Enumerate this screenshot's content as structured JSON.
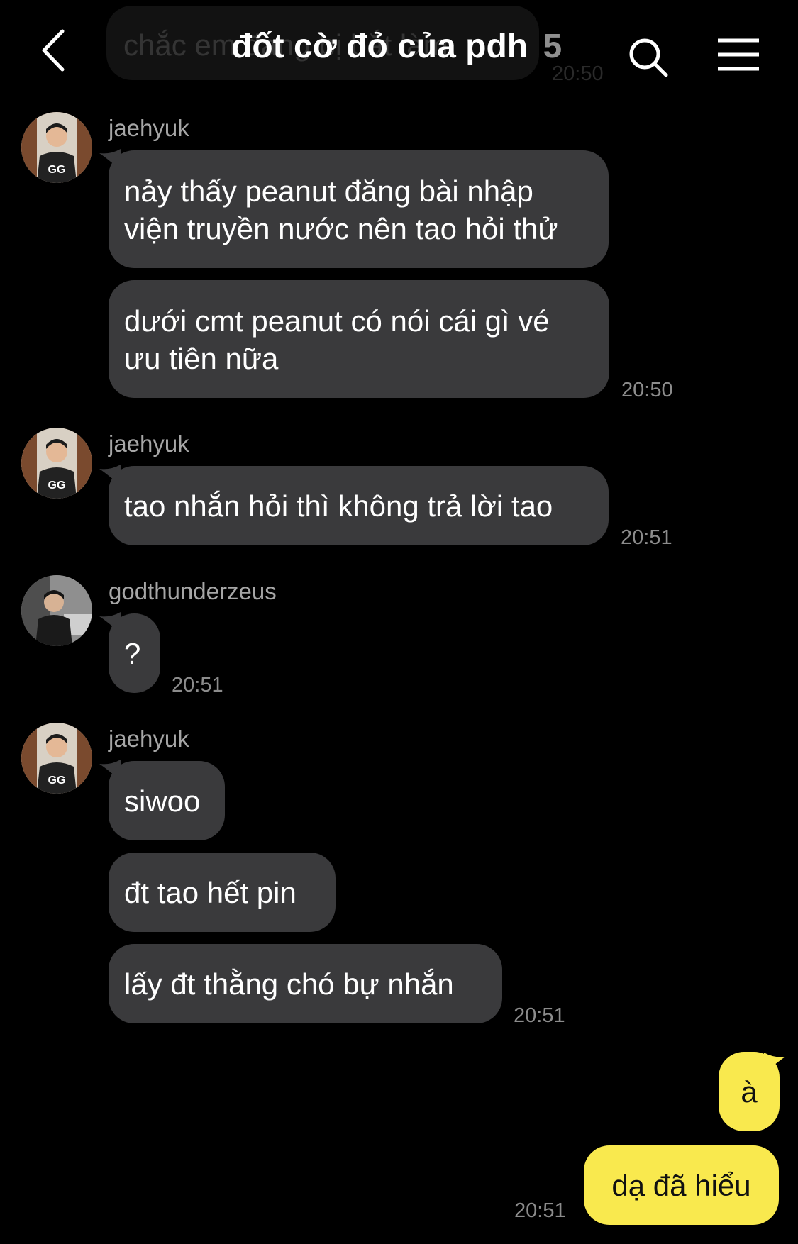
{
  "header": {
    "title": "đốt cờ đỏ của pdh",
    "member_count": "5",
    "ghost_message": "chắc em đang bị bắt làm",
    "ghost_time": "20:50"
  },
  "colors": {
    "background": "#000000",
    "bubble_other": "#3a3a3c",
    "bubble_mine": "#f9e94e",
    "timestamp": "#8c8c8c"
  },
  "icons": {
    "back": "chevron-left-icon",
    "search": "search-icon",
    "menu": "hamburger-menu-icon"
  },
  "messages": [
    {
      "sender": "jaehyuk",
      "bubbles": [
        {
          "text": "nảy thấy peanut đăng bài nhập\nviện truyền nước nên tao hỏi thử"
        },
        {
          "text": "dưới cmt peanut có nói cái gì vé\nưu tiên nữa"
        }
      ],
      "time": "20:50"
    },
    {
      "sender": "jaehyuk",
      "bubbles": [
        {
          "text": "tao nhắn hỏi thì không trả lời tao"
        }
      ],
      "time": "20:51"
    },
    {
      "sender": "godthunderzeus",
      "bubbles": [
        {
          "text": "?"
        }
      ],
      "time": "20:51"
    },
    {
      "sender": "jaehyuk",
      "bubbles": [
        {
          "text": "siwoo"
        },
        {
          "text": "đt tao hết pin"
        },
        {
          "text": "lấy đt thằng chó bự nhắn"
        }
      ],
      "time": "20:51"
    }
  ],
  "my_messages": {
    "bubbles": [
      {
        "text": "à"
      },
      {
        "text": "dạ đã hiểu"
      }
    ],
    "time": "20:51"
  }
}
